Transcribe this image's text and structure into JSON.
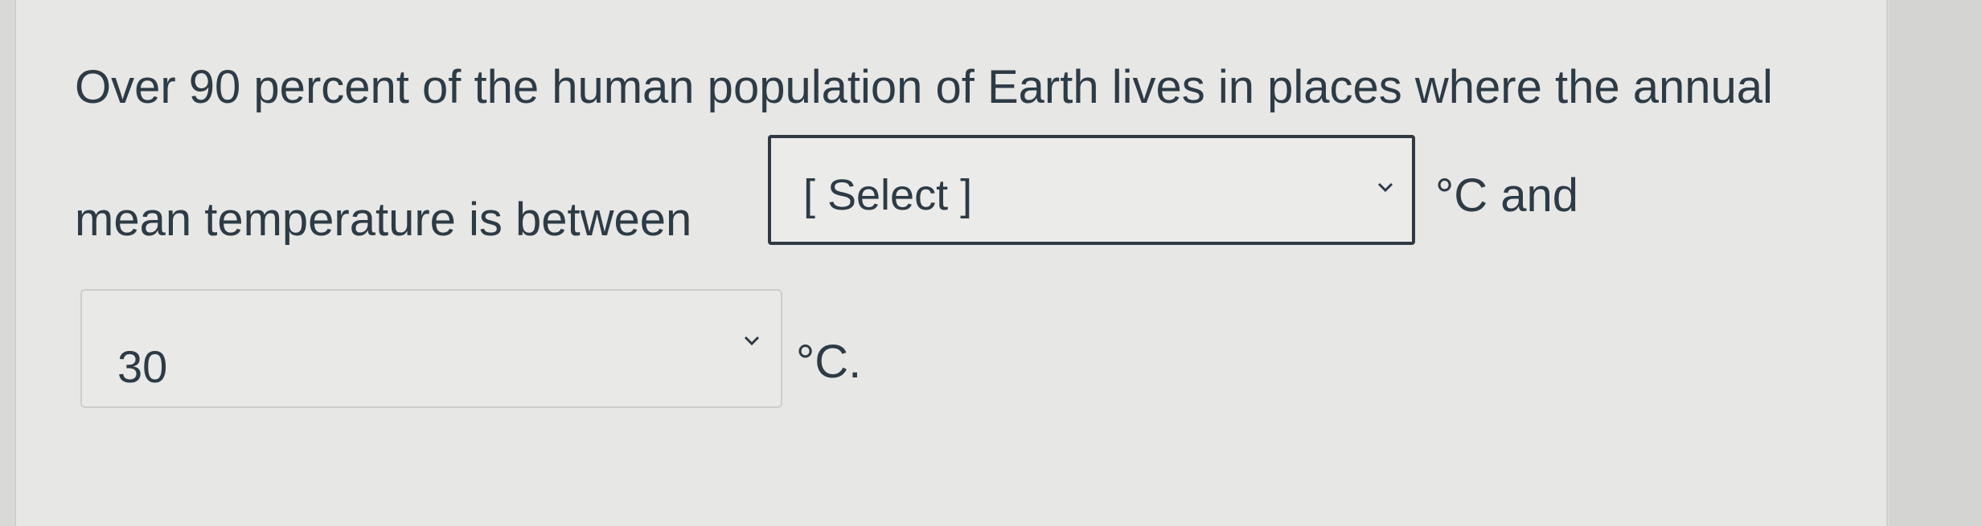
{
  "question": {
    "line1": "Over 90 percent of the human population of Earth lives in places where the annual",
    "line2_prefix": "mean temperature is between",
    "after_first_select": "°C and",
    "after_second_select": "°C."
  },
  "dropdowns": [
    {
      "selected_value": "[ Select ]",
      "state": "focused",
      "icon": "chevron-down-icon"
    },
    {
      "selected_value": "30",
      "state": "filled",
      "icon": "chevron-down-icon"
    }
  ],
  "colors": {
    "text": "#2d3b45",
    "focus_border": "#2f3a42",
    "panel_bg": "#e7e7e5"
  }
}
